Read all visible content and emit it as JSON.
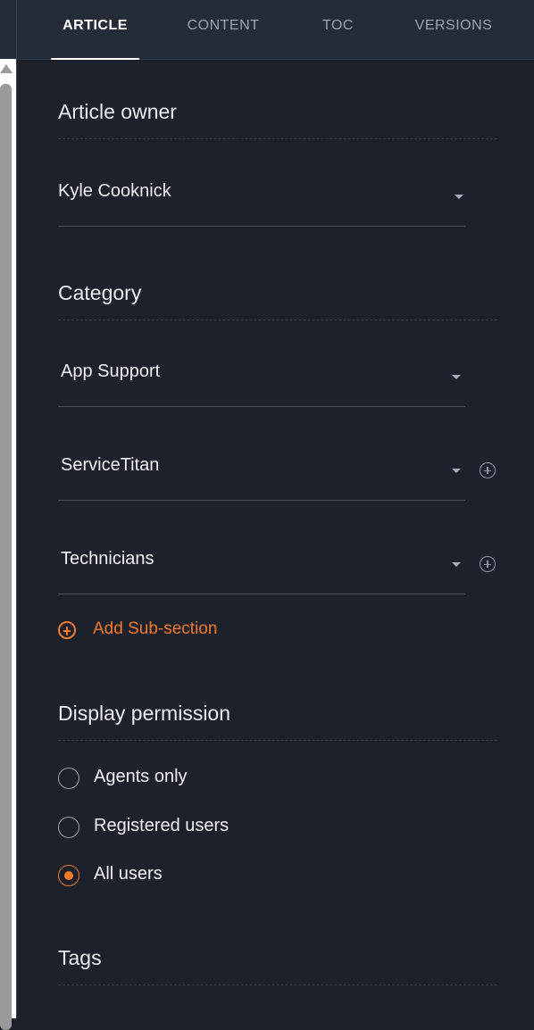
{
  "tabs": [
    {
      "label": "ARTICLE",
      "active": true
    },
    {
      "label": "CONTENT",
      "active": false
    },
    {
      "label": "TOC",
      "active": false
    },
    {
      "label": "VERSIONS",
      "active": false
    }
  ],
  "article_owner": {
    "title": "Article owner",
    "value": "Kyle Cooknick"
  },
  "category": {
    "title": "Category",
    "levels": [
      {
        "value": "App Support"
      },
      {
        "value": "ServiceTitan"
      },
      {
        "value": "Technicians"
      }
    ],
    "add_sub_section_label": "Add Sub-section"
  },
  "display_permission": {
    "title": "Display permission",
    "options": [
      {
        "label": "Agents only",
        "selected": false
      },
      {
        "label": "Registered users",
        "selected": false
      },
      {
        "label": "All users",
        "selected": true
      }
    ]
  },
  "tags": {
    "title": "Tags"
  },
  "colors": {
    "background": "#1c212b",
    "tabbar": "#252b37",
    "accent": "#f47a2a"
  }
}
